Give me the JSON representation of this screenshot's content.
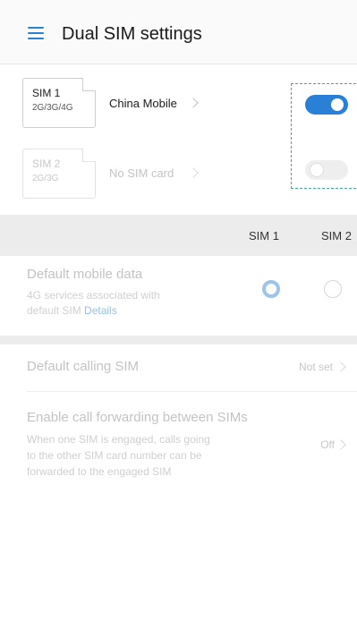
{
  "header": {
    "title": "Dual SIM settings",
    "menu_icon": "menu-icon"
  },
  "sims": [
    {
      "name": "SIM 1",
      "tech": "2G/3G/4G",
      "carrier": "China Mobile",
      "enabled": true
    },
    {
      "name": "SIM 2",
      "tech": "2G/3G",
      "carrier": "No SIM card",
      "enabled": false
    }
  ],
  "columns": {
    "sim1": "SIM 1",
    "sim2": "SIM 2"
  },
  "default_mobile_data": {
    "title": "Default mobile data",
    "subtitle_line1": "4G services associated with",
    "subtitle_line2": "default SIM ",
    "details_link": "Details",
    "selected": "SIM 1"
  },
  "default_calling_sim": {
    "title": "Default calling SIM",
    "value": "Not set"
  },
  "call_forwarding": {
    "title": "Enable call forwarding between SIMs",
    "subtitle_line1": "When one SIM is engaged, calls going",
    "subtitle_line2": "to the other SIM card number can be",
    "subtitle_line3": "forwarded to the engaged SIM",
    "value": "Off"
  },
  "colors": {
    "accent": "#2a7fd6",
    "highlight": "#3aa6a6",
    "section_bg": "#ececec"
  }
}
